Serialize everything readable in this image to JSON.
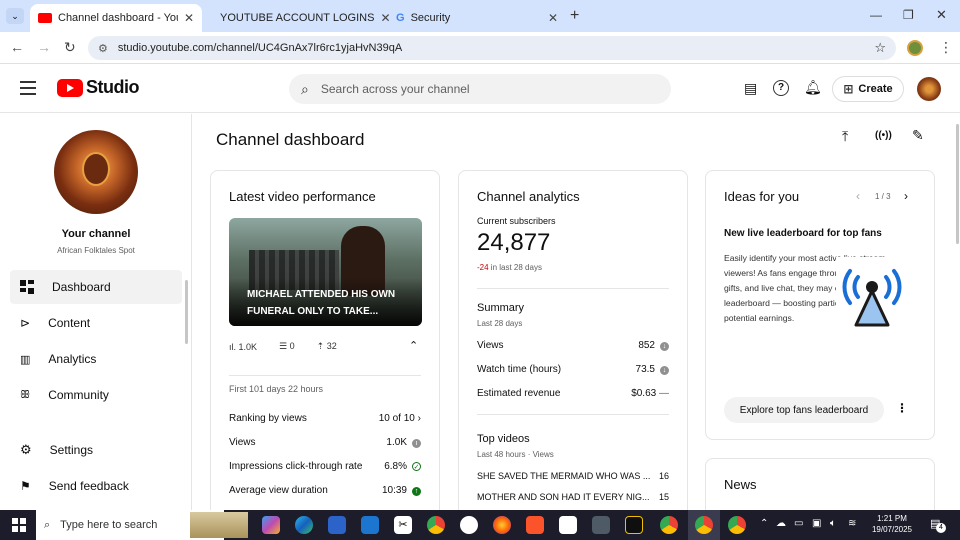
{
  "browser": {
    "tabs": [
      {
        "label": "Channel dashboard - YouTube",
        "active": true
      },
      {
        "label": "YOUTUBE ACCOUNT LOGINS",
        "active": false
      },
      {
        "label": "Security",
        "active": false
      }
    ],
    "url": "studio.youtube.com/channel/UC4GnAx7lr6rc1yjaHvN39qA"
  },
  "header": {
    "logo_text": "Studio",
    "search_placeholder": "Search across your channel",
    "create_label": "Create"
  },
  "sidebar": {
    "channel_title": "Your channel",
    "channel_name": "African Folktales Spot",
    "items": [
      {
        "label": "Dashboard",
        "icon": "dashboard-icon"
      },
      {
        "label": "Content",
        "icon": "content-icon"
      },
      {
        "label": "Analytics",
        "icon": "analytics-icon"
      },
      {
        "label": "Community",
        "icon": "community-icon"
      },
      {
        "label": "Settings",
        "icon": "gear-icon"
      },
      {
        "label": "Send feedback",
        "icon": "feedback-icon"
      }
    ]
  },
  "main": {
    "page_title": "Channel dashboard",
    "latest": {
      "title": "Latest video performance",
      "thumb_caption": "MICHAEL ATTENDED HIS OWN FUNERAL ONLY TO TAKE...",
      "stats": {
        "views": "1.0K",
        "comments": "0",
        "likes": "32"
      },
      "period": "First 101 days 22 hours",
      "ranking_label": "Ranking by views",
      "ranking_value": "10 of 10",
      "views_label": "Views",
      "views_value": "1.0K",
      "ctr_label": "Impressions click-through rate",
      "ctr_value": "6.8%",
      "avd_label": "Average view duration",
      "avd_value": "10:39"
    },
    "analytics": {
      "title": "Channel analytics",
      "subs_label": "Current subscribers",
      "subs_value": "24,877",
      "subs_change": "-24",
      "subs_change_suffix": "in last 28 days",
      "summary_title": "Summary",
      "summary_period": "Last 28 days",
      "views_label": "Views",
      "views_value": "852",
      "watch_label": "Watch time (hours)",
      "watch_value": "73.5",
      "revenue_label": "Estimated revenue",
      "revenue_value": "$0.63",
      "revenue_trend": "—",
      "top_title": "Top videos",
      "top_period": "Last 48 hours · Views",
      "top": [
        {
          "title": "SHE SAVED THE MERMAID WHO WAS ...",
          "views": "16"
        },
        {
          "title": "MOTHER AND SON HAD IT EVERY NIG...",
          "views": "15"
        }
      ]
    },
    "ideas": {
      "title": "Ideas for you",
      "pager": "1 / 3",
      "card_title": "New live leaderboard for top fans",
      "body": "Easily identify your most active live stream viewers! As fans engage through Super Chats, gifts, and live chat, they may climb the leaderboard — boosting participation and your potential earnings.",
      "button": "Explore top fans leaderboard"
    },
    "news_title": "News"
  },
  "taskbar": {
    "search_placeholder": "Type here to search",
    "time": "1:21 PM",
    "date": "19/07/2025",
    "notifications": "4"
  },
  "colors": {
    "yt_red": "#ff0000",
    "accent_blue": "#065fd4",
    "negative": "#cc0000",
    "positive": "#107516"
  }
}
